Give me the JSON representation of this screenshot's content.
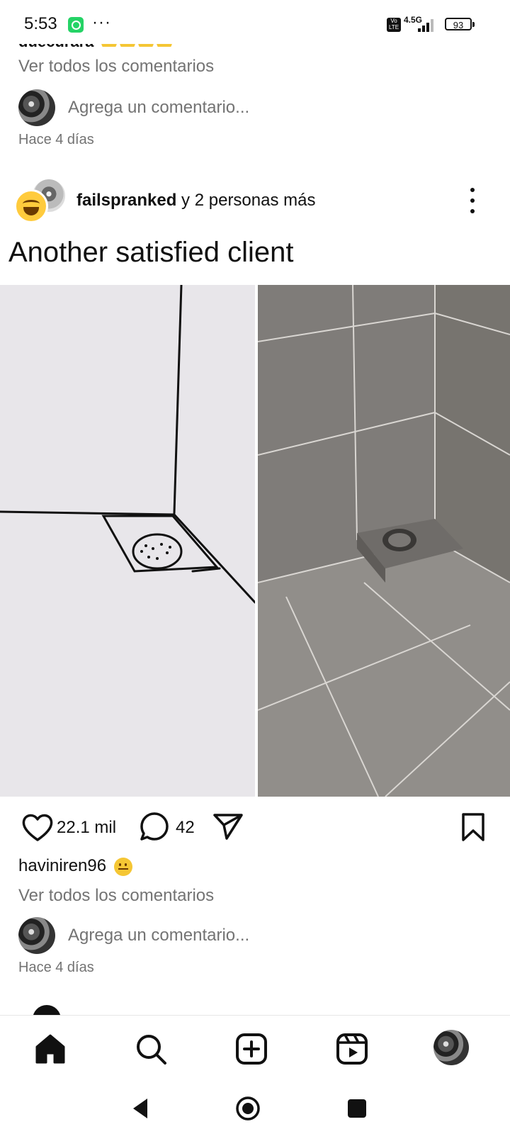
{
  "status_bar": {
    "time": "5:53",
    "more": "···",
    "volte": "Vo LTE",
    "network": "4.5G",
    "battery": "93"
  },
  "prev_post": {
    "cut_text": "quecurara",
    "view_comments": "Ver todos los comentarios",
    "add_comment_placeholder": "Agrega un comentario...",
    "timestamp": "Hace 4 días"
  },
  "post": {
    "author": "failspranked",
    "author_suffix": " y 2 personas más",
    "caption": "Another satisfied client",
    "likes": "22.1 mil",
    "comments": "42",
    "liked_by": "haviniren96",
    "view_comments": "Ver todos los comentarios",
    "add_comment_placeholder": "Agrega un comentario...",
    "timestamp": "Hace 4 días"
  },
  "icons": {
    "like": "heart-icon",
    "comment": "comment-bubble-icon",
    "share": "paper-plane-icon",
    "save": "bookmark-icon",
    "nav": [
      "home-icon",
      "search-icon",
      "create-icon",
      "reels-icon",
      "profile-avatar"
    ],
    "system": [
      "back-icon",
      "home-circle-icon",
      "recents-icon"
    ]
  },
  "colors": {
    "text": "#111111",
    "secondary_text": "#737373",
    "background": "#ffffff"
  }
}
